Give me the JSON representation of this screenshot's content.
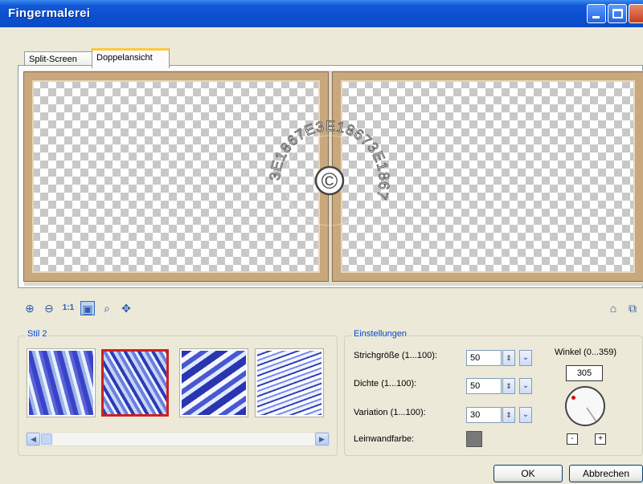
{
  "window": {
    "title": "Fingermalerei",
    "controls": [
      "minimize-icon",
      "maximize-icon",
      "close-icon"
    ]
  },
  "tabs": [
    {
      "label": "Split-Screen",
      "active": false
    },
    {
      "label": "Doppelansicht",
      "active": true
    }
  ],
  "preview": {
    "watermark": {
      "text": "3E1867E3E18673E1867",
      "symbol": "©"
    }
  },
  "zoom_toolbar": {
    "icons": [
      "zoom-in-icon",
      "zoom-out-icon",
      "actual-size-icon",
      "fit-window-icon",
      "zoom-box-icon",
      "pan-icon"
    ],
    "actual_size_label": "1:1",
    "right_icons": [
      "proof-icon",
      "preview-icon"
    ]
  },
  "style_group": {
    "legend": "Stil 2",
    "thumbnails": [
      "Stil 1",
      "Stil 2",
      "Stil 3",
      "Stil 4"
    ],
    "selected_index": 1
  },
  "settings": {
    "legend": "Einstellungen",
    "stroke_size": {
      "label": "Strichgröße (1...100):",
      "value": "50"
    },
    "density": {
      "label": "Dichte (1...100):",
      "value": "50"
    },
    "variation": {
      "label": "Variation (1...100):",
      "value": "30"
    },
    "canvas_color": {
      "label": "Leinwandfarbe:",
      "color": "#787878"
    },
    "angle": {
      "label": "Winkel (0...359)",
      "value": "305"
    },
    "step_minus": "-",
    "step_plus": "+"
  },
  "actions": {
    "ok": "OK",
    "cancel": "Abbrechen"
  },
  "colors": {
    "titlebar": "#0a4fd0",
    "dialog_bg": "#ece9d8",
    "frame": "#c9a87e",
    "legend_text": "#0046d5",
    "selected_thumb_border": "#d02020"
  }
}
